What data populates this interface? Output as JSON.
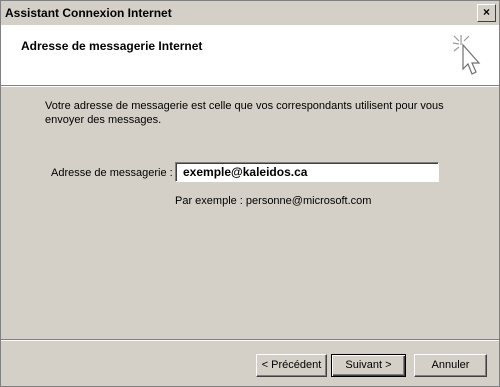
{
  "window": {
    "title": "Assistant Connexion Internet",
    "close_glyph": "×"
  },
  "header": {
    "title": "Adresse de messagerie Internet",
    "icon": "wizard-sparkle-cursor-icon"
  },
  "body": {
    "description": "Votre adresse de messagerie est celle que vos correspondants utilisent pour vous envoyer des messages.",
    "email_label": "Adresse de messagerie :",
    "email_value": "exemple@kaleidos.ca",
    "example_text": "Par exemple : personne@microsoft.com"
  },
  "buttons": {
    "prev": "< Précédent",
    "next": "Suivant >",
    "cancel": "Annuler"
  }
}
